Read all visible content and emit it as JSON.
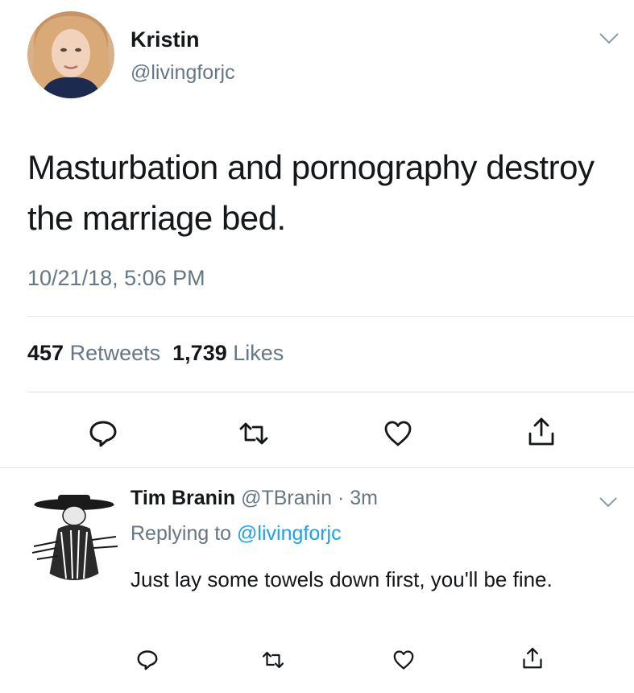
{
  "main_tweet": {
    "display_name": "Kristin",
    "handle": "@livingforjc",
    "text": "Masturbation and pornography destroy the marriage bed.",
    "timestamp": "10/21/18, 5:06 PM",
    "retweets_count": "457",
    "retweets_label": "Retweets",
    "likes_count": "1,739",
    "likes_label": "Likes",
    "actions": [
      "reply-icon",
      "retweet-icon",
      "like-icon",
      "share-icon"
    ]
  },
  "reply_tweet": {
    "display_name": "Tim Branin",
    "handle": "@TBranin",
    "time_ago": "3m",
    "replying_prefix": "Replying to",
    "replying_to": "@livingforjc",
    "text": "Just lay some towels down first, you'll be fine.",
    "actions": [
      "reply-icon",
      "retweet-icon",
      "like-icon",
      "share-icon"
    ]
  },
  "colors": {
    "text_primary": "#14171a",
    "text_secondary": "#657786",
    "link": "#1da1f2",
    "divider": "#dfe4e8"
  }
}
